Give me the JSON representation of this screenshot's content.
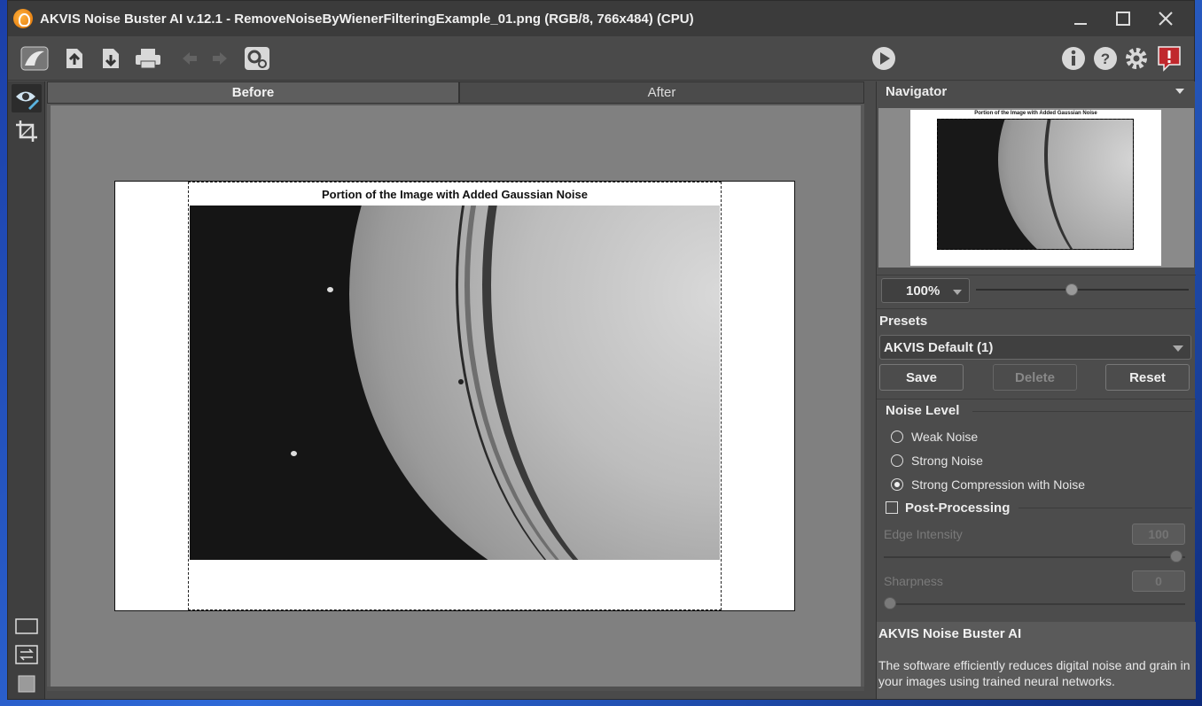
{
  "window": {
    "title": "AKVIS Noise Buster AI v.12.1 - RemoveNoiseByWienerFilteringExample_01.png (RGB/8, 766x484) (CPU)"
  },
  "toolbar": {
    "icons": [
      "akvis-home-icon",
      "open-file-icon",
      "save-file-icon",
      "print-icon",
      "undo-icon",
      "redo-icon",
      "batch-settings-icon",
      "run-icon",
      "info-icon",
      "help-icon",
      "settings-icon",
      "notification-icon"
    ]
  },
  "tabs": {
    "before": "Before",
    "after": "After"
  },
  "image": {
    "caption": "Portion of the Image with Added Gaussian Noise"
  },
  "navigator": {
    "title": "Navigator",
    "caption": "Portion of the Image with Added Gaussian Noise",
    "zoom": "100%",
    "zoom_level": 0.45
  },
  "presets": {
    "title": "Presets",
    "selected": "AKVIS Default (1)",
    "save_label": "Save",
    "delete_label": "Delete",
    "reset_label": "Reset"
  },
  "noise_level": {
    "title": "Noise Level",
    "options": [
      {
        "label": "Weak Noise",
        "selected": false
      },
      {
        "label": "Strong Noise",
        "selected": false
      },
      {
        "label": "Strong Compression with Noise",
        "selected": true
      }
    ]
  },
  "post_processing": {
    "label": "Post-Processing",
    "checked": false,
    "edge_intensity_label": "Edge Intensity",
    "edge_intensity_value": "100",
    "sharpness_label": "Sharpness",
    "sharpness_value": "0"
  },
  "info": {
    "title": "AKVIS Noise Buster AI",
    "description": "The software efficiently reduces digital noise and grain in your images using trained neural networks."
  },
  "colors": {
    "panel_bg": "#4c4c4c",
    "titlebar_bg": "#3b3b3b",
    "canvas_bg": "#808080",
    "notification_red": "#c0282d"
  }
}
